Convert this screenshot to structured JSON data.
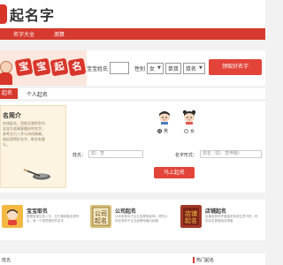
{
  "logo": {
    "text": "起名字"
  },
  "nav": {
    "items": [
      "名字大全",
      "测算"
    ]
  },
  "banner": {
    "title_chars": [
      "宝",
      "宝",
      "起",
      "名"
    ],
    "surname_label": "宝宝姓氏",
    "gender_label": "性别",
    "gender_value": "女",
    "name_type_value": "单双",
    "name_count_value": "双名",
    "submit_label": "领取好名字"
  },
  "tabs": {
    "active": "起名",
    "other": "个人起名"
  },
  "intro": {
    "title": "名简介",
    "text": "在线起名，用姓氏和性别为宝宝生成寓意美好的名字，参考五行八字与诗词典故，轻松获得好名字，取名有意义。"
  },
  "form": {
    "male_label": "男",
    "female_label": "女",
    "surname_label": "姓氏：",
    "surname_placeholder": "如：李",
    "name_type_label": "名字形式：",
    "name_type_placeholder": "双名（如：李梓萌）",
    "submit_label": "马上起名"
  },
  "services": [
    {
      "title": "宝宝取名",
      "desc": "根据宝宝生辰八字、五行喜用取吉祥好名，有一个寓意美好的名字",
      "icon": "baby-icon",
      "color": "#f3b943"
    },
    {
      "title": "公司起名",
      "desc": "公司名称对于企业发展有影响，好的公司名有利于企业品牌传播与经营",
      "icon": "company-icon",
      "color": "#d7c07a"
    },
    {
      "title": "店铺起名",
      "desc": "店铺名称好坏直接关系到生意兴旺，好的店名更能吸引顾客",
      "icon": "shop-icon",
      "color": "#a13a28"
    }
  ],
  "bottom": {
    "left": "姓氏",
    "right": "热门起名"
  },
  "colors": {
    "accent": "#d63a2e",
    "button": "#e2443a"
  }
}
